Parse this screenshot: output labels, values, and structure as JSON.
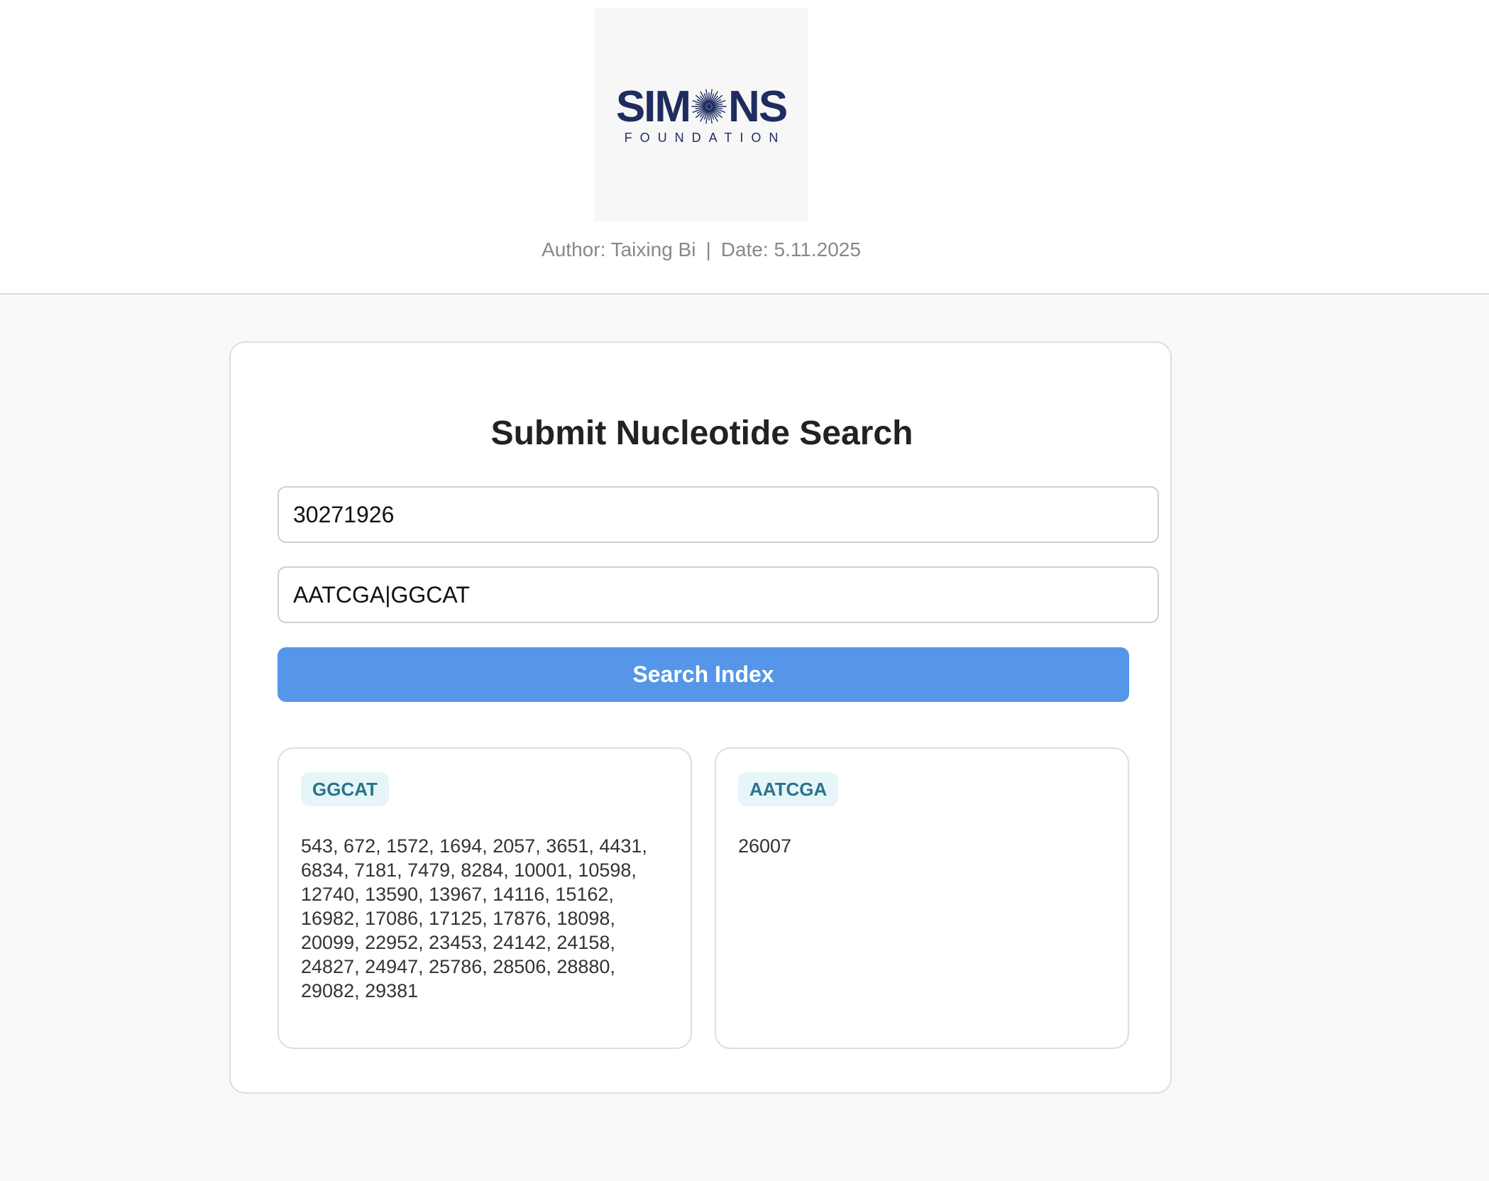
{
  "header": {
    "logo": {
      "name": "SIMONS",
      "left_text": "SIM",
      "right_text": "NS",
      "subtitle": "FOUNDATION",
      "icon": "sunburst-icon",
      "brand_color": "#1e2c5f"
    },
    "author": "Author: Taixing Bi",
    "separator": "|",
    "date": "Date: 5.11.2025"
  },
  "form": {
    "title": "Submit Nucleotide Search",
    "accession_value": "30271926",
    "pattern_value": "AATCGA|GGCAT",
    "search_button_label": "Search Index",
    "accent_color": "#5596e8"
  },
  "results": [
    {
      "pattern": "GGCAT",
      "positions": "543, 672, 1572, 1694, 2057, 3651, 4431, 6834, 7181, 7479, 8284, 10001, 10598, 12740, 13590, 13967, 14116, 15162, 16982, 17086, 17125, 17876, 18098, 20099, 22952, 23453, 24142, 24158, 24827, 24947, 25786, 28506, 28880, 29082, 29381"
    },
    {
      "pattern": "AATCGA",
      "positions": "26007"
    }
  ]
}
